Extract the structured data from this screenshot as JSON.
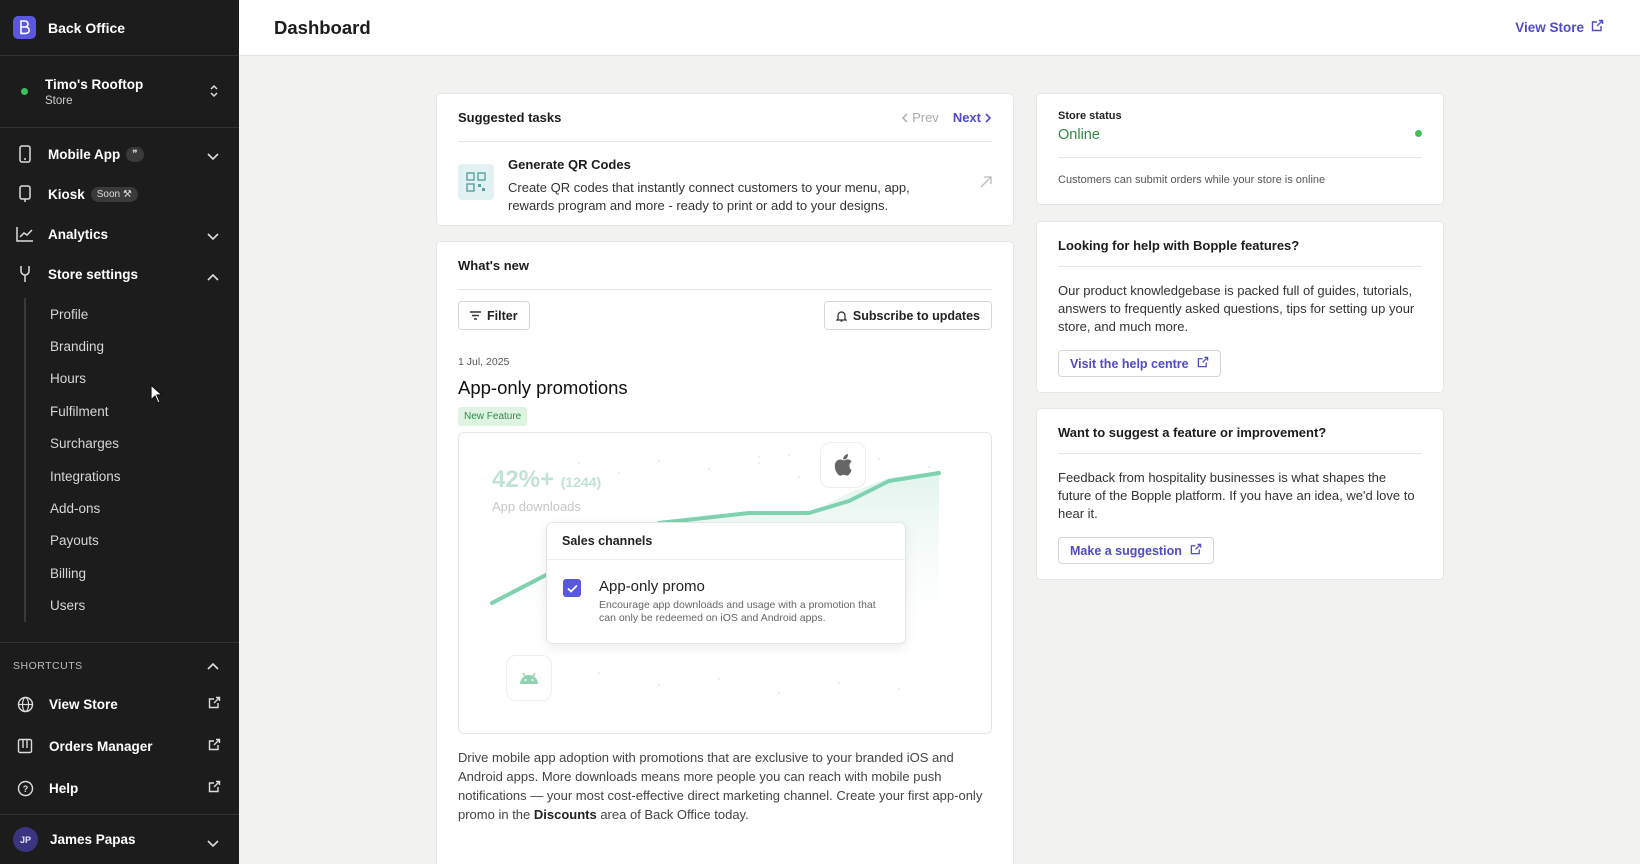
{
  "brand": {
    "name": "Back Office",
    "accent": "#5b57e0"
  },
  "store": {
    "name": "Timo's Rooftop",
    "type": "Store"
  },
  "nav": {
    "mobile_app": "Mobile App",
    "kiosk": "Kiosk",
    "kiosk_badge": "Soon",
    "analytics": "Analytics",
    "store_settings": "Store settings",
    "settings_items": [
      "Profile",
      "Branding",
      "Hours",
      "Fulfilment",
      "Surcharges",
      "Integrations",
      "Add-ons",
      "Payouts",
      "Billing",
      "Users"
    ]
  },
  "shortcuts": {
    "heading": "SHORTCUTS",
    "items": [
      "View Store",
      "Orders Manager",
      "Help"
    ]
  },
  "user": {
    "initials": "JP",
    "name": "James Papas"
  },
  "topbar": {
    "title": "Dashboard",
    "view_store": "View Store"
  },
  "tasks": {
    "title": "Suggested tasks",
    "prev": "Prev",
    "next": "Next",
    "item_title": "Generate QR Codes",
    "item_desc": "Create QR codes that instantly connect customers to your menu, app, rewards program and more - ready to print or add to your designs."
  },
  "whats_new": {
    "title": "What's new",
    "filter": "Filter",
    "subscribe": "Subscribe to updates",
    "date": "1 Jul, 2025",
    "post_title": "App-only promotions",
    "badge": "New Feature",
    "illus_stat": "42%+",
    "illus_stat_count": "(1244)",
    "illus_sub": "App downloads",
    "popup_title": "Sales channels",
    "promo_name": "App-only promo",
    "promo_desc": "Encourage app downloads and usage with a promotion that can only be redeemed on iOS and Android apps.",
    "body_1": "Drive mobile app adoption with promotions that are exclusive to your branded iOS and Android apps. More downloads means more people you can reach with mobile push notifications — your most cost-effective direct marketing channel. Create your first app-only promo in the ",
    "body_bold": "Discounts",
    "body_2": " area of Back Office today."
  },
  "status": {
    "label": "Store status",
    "value": "Online",
    "note": "Customers can submit orders while your store is online",
    "color": "#2f8a44"
  },
  "help": {
    "title": "Looking for help with Bopple features?",
    "body": "Our product knowledgebase is packed full of guides, tutorials, answers to frequently asked questions, tips for setting up your store, and much more.",
    "link": "Visit the help centre"
  },
  "suggest": {
    "title": "Want to suggest a feature or improvement?",
    "body": "Feedback from hospitality businesses is what shapes the future of the Bopple platform. If you have an idea, we'd love to hear it.",
    "link": "Make a suggestion"
  }
}
